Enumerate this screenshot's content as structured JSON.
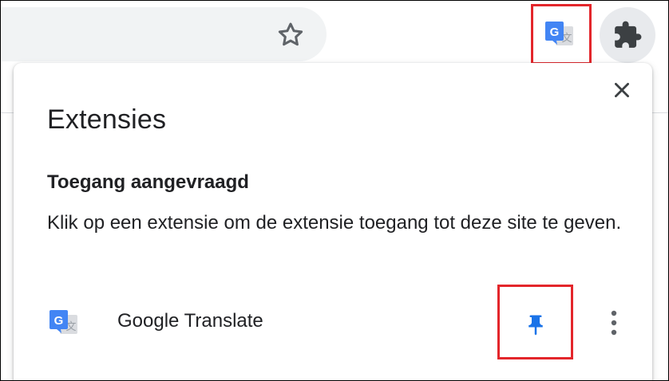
{
  "toolbar": {
    "bookmark_icon": "star-outline-icon",
    "pinned_extension_icon": "google-translate-icon",
    "extensions_menu_icon": "puzzle-piece-icon"
  },
  "popup": {
    "title": "Extensies",
    "close_icon": "close-icon",
    "section": {
      "heading": "Toegang aangevraagd",
      "description": "Klik op een extensie om de extensie toegang tot deze site te geven."
    },
    "extensions": [
      {
        "name": "Google Translate",
        "icon": "google-translate-icon",
        "pin_icon": "pin-icon",
        "pinned": true,
        "menu_icon": "more-vert-icon"
      }
    ]
  },
  "colors": {
    "highlight": "#e3262b",
    "pin_active": "#1a73e8",
    "translate_blue": "#4285f4",
    "icon_gray": "#5f6368",
    "toolbar_field": "#f1f3f4",
    "text": "#202124"
  }
}
